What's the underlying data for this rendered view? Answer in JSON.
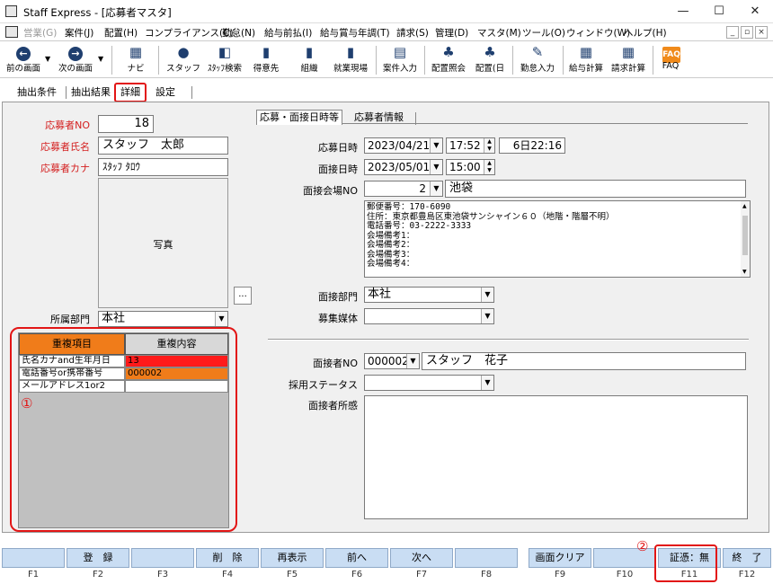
{
  "window": {
    "title": "Staff Express - [応募者マスタ]",
    "minimize": "—",
    "maximize": "☐",
    "close": "✕"
  },
  "menu": [
    {
      "label": "営業(G)",
      "disabled": true
    },
    {
      "label": "案件(J)"
    },
    {
      "label": "配置(H)"
    },
    {
      "label": "コンプライアンス(C)"
    },
    {
      "label": "勤怠(N)"
    },
    {
      "label": "給与前払(I)"
    },
    {
      "label": "給与賞与年調(T)"
    },
    {
      "label": "請求(S)"
    },
    {
      "label": "管理(D)"
    },
    {
      "label": "マスタ(M)"
    },
    {
      "label": "ツール(O)"
    },
    {
      "label": "ウィンドウ(W)"
    },
    {
      "label": "ヘルプ(H)"
    }
  ],
  "toolbar": [
    {
      "label": "前の画面",
      "icon": "arrow-left-icon"
    },
    {
      "label": "次の画面",
      "icon": "arrow-right-icon"
    },
    {
      "label": "ナビ",
      "icon": "navi-icon"
    },
    {
      "label": "スタッフ",
      "icon": "staff-icon"
    },
    {
      "label": "ｽﾀｯﾌ検索",
      "icon": "staff-search-icon"
    },
    {
      "label": "得意先",
      "icon": "client-icon"
    },
    {
      "label": "組織",
      "icon": "organization-icon"
    },
    {
      "label": "就業現場",
      "icon": "workplace-icon"
    },
    {
      "label": "案件入力",
      "icon": "job-entry-icon"
    },
    {
      "label": "配置照会",
      "icon": "placement-inquiry-icon"
    },
    {
      "label": "配置(日",
      "icon": "placement-daily-icon"
    },
    {
      "label": "勤怠入力",
      "icon": "attendance-entry-icon"
    },
    {
      "label": "給与計算",
      "icon": "payroll-icon"
    },
    {
      "label": "請求計算",
      "icon": "billing-icon"
    },
    {
      "label": "FAQ",
      "icon": "faq-icon"
    }
  ],
  "tabs": [
    "抽出条件",
    "抽出結果",
    "詳細",
    "設定"
  ],
  "left": {
    "applicant_no_label": "応募者NO",
    "applicant_no": "18",
    "name_label": "応募者氏名",
    "name": "スタッフ　太郎",
    "kana_label": "応募者カナ",
    "kana": "ｽﾀｯﾌ ﾀﾛｳ",
    "photo_label": "写真",
    "photo_button": "...",
    "dept_label": "所属部門",
    "dept": "本社",
    "dup_header_item": "重複項目",
    "dup_header_content": "重複内容",
    "dup_rows": [
      {
        "item": "氏名カナand生年月日",
        "value": "13",
        "color": "#ff1a1a"
      },
      {
        "item": "電話番号or携帯番号",
        "value": "000002",
        "color": "#f07c1a"
      },
      {
        "item": "メールアドレス1or2",
        "value": "",
        "color": "#ffffff"
      }
    ],
    "annotation": "①"
  },
  "right": {
    "tab1": "応募・面接日時等",
    "tab2": "応募者情報",
    "apply_dt_label": "応募日時",
    "apply_date": "2023/04/21",
    "apply_time": "17:52",
    "elapsed": "6日22:16",
    "interview_dt_label": "面接日時",
    "interview_date": "2023/05/01",
    "interview_time": "15:00",
    "venue_label": "面接会場NO",
    "venue_no": "2",
    "venue_name": "池袋",
    "venue_info": [
      "郵便番号：170-6090",
      "住所：東京都豊島区東池袋サンシャイン６０（地階・階層不明）",
      "電話番号：03-2222-3333",
      "会場備考1：",
      "会場備考2：",
      "会場備考3：",
      "会場備考4："
    ],
    "interview_dept_label": "面接部門",
    "interview_dept": "本社",
    "media_label": "募集媒体",
    "media": "",
    "interviewer_label": "面接者NO",
    "interviewer_no": "000002",
    "interviewer_name": "スタッフ　花子",
    "status_label": "採用ステータス",
    "status": "",
    "comment_label": "面接者所感",
    "comment": ""
  },
  "fkeys": [
    {
      "label": "",
      "num": "F1"
    },
    {
      "label": "登　録",
      "num": "F2"
    },
    {
      "label": "",
      "num": "F3"
    },
    {
      "label": "削　除",
      "num": "F4"
    },
    {
      "label": "再表示",
      "num": "F5"
    },
    {
      "label": "前へ",
      "num": "F6"
    },
    {
      "label": "次へ",
      "num": "F7"
    },
    {
      "label": "",
      "num": "F8"
    },
    {
      "label": "画面クリア",
      "num": "F9"
    },
    {
      "label": "",
      "num": "F10"
    },
    {
      "label": "証憑：無",
      "num": "F11"
    },
    {
      "label": "終　了",
      "num": "F12"
    }
  ],
  "annotation2": "②",
  "colors": {
    "accent_red": "#e21515",
    "fkey_blue": "#c9ddf3",
    "dup_orange": "#f07c1a"
  }
}
